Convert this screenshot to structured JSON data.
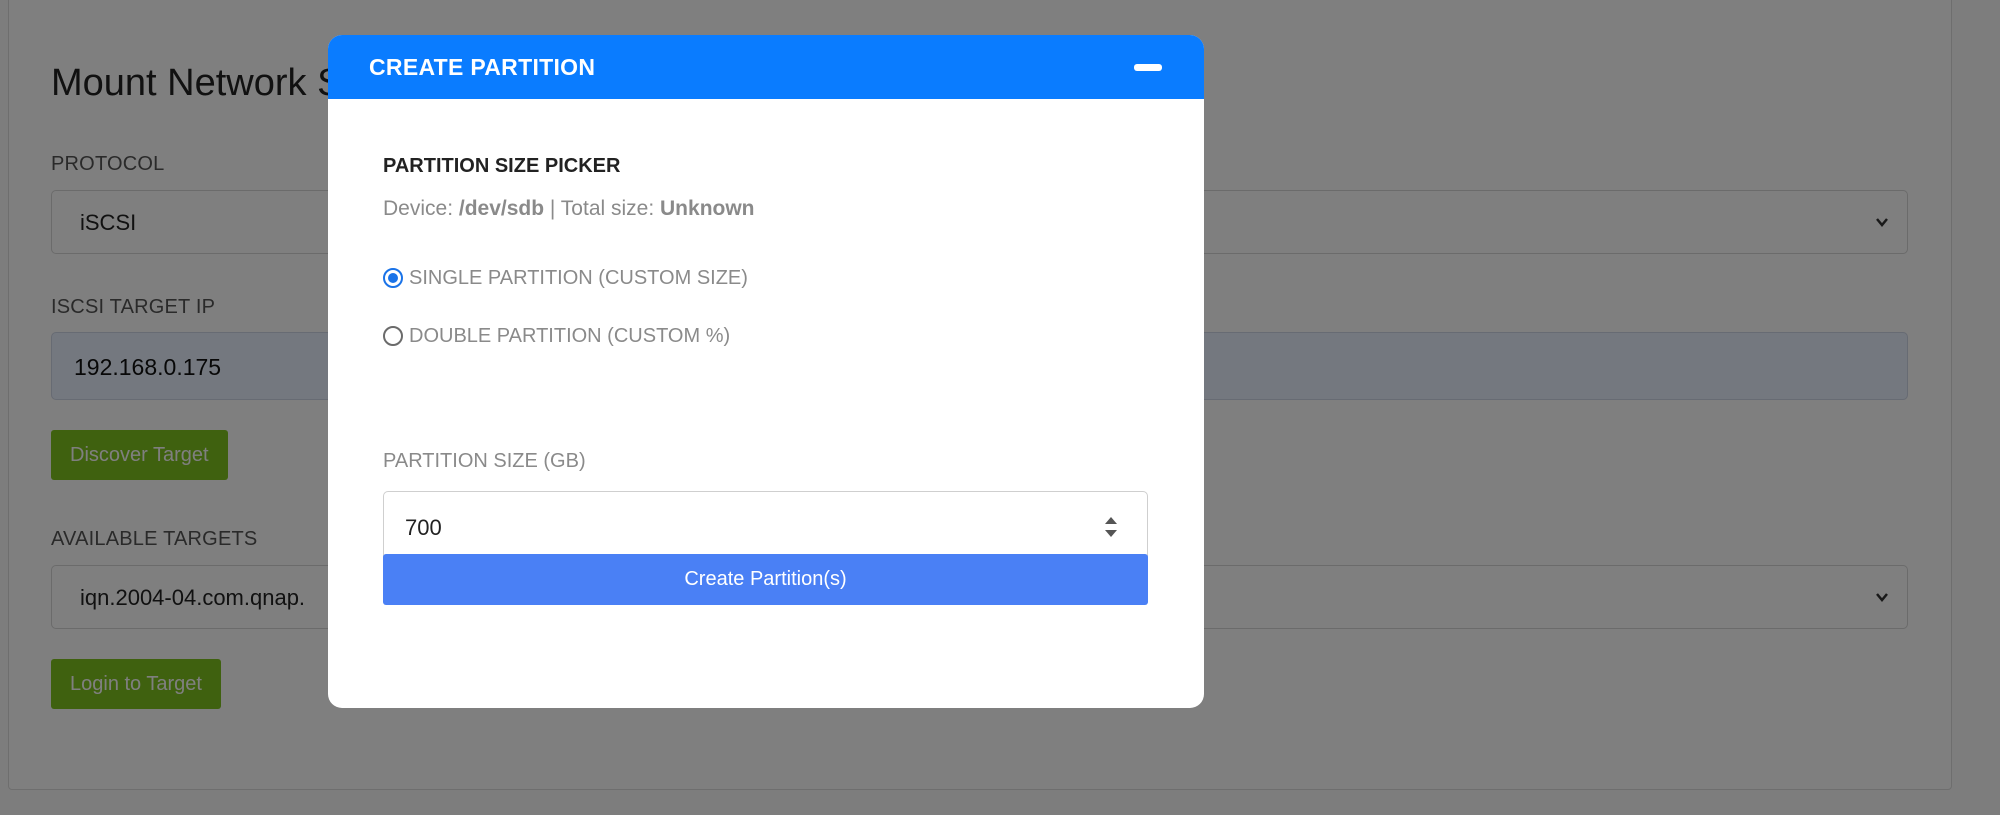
{
  "background": {
    "title": "Mount Network S",
    "protocol": {
      "label": "PROTOCOL",
      "value": "iSCSI"
    },
    "target_ip": {
      "label": "ISCSI TARGET IP",
      "value": "192.168.0.175"
    },
    "discover_button": "Discover Target",
    "available_targets": {
      "label": "AVAILABLE TARGETS",
      "value": "iqn.2004-04.com.qnap."
    },
    "login_button": "Login to Target"
  },
  "modal": {
    "title": "CREATE PARTITION",
    "picker_heading": "PARTITION SIZE PICKER",
    "device": {
      "prefix": "Device: ",
      "name": "/dev/sdb",
      "separator": " | Total size: ",
      "total_size": "Unknown"
    },
    "options": [
      {
        "label": "SINGLE PARTITION (CUSTOM SIZE)",
        "checked": true
      },
      {
        "label": "DOUBLE PARTITION (CUSTOM %)",
        "checked": false
      }
    ],
    "size_label": "PARTITION SIZE (GB)",
    "size_value": "700",
    "create_button": "Create Partition(s)"
  },
  "colors": {
    "header_blue": "#0a7cff",
    "primary_button": "#4a80f5",
    "green_button": "#7fc31e",
    "overlay": "rgba(0,0,0,0.5)"
  },
  "icons": [
    "minimize-icon",
    "chevron-down-icon",
    "spinner-icon"
  ]
}
